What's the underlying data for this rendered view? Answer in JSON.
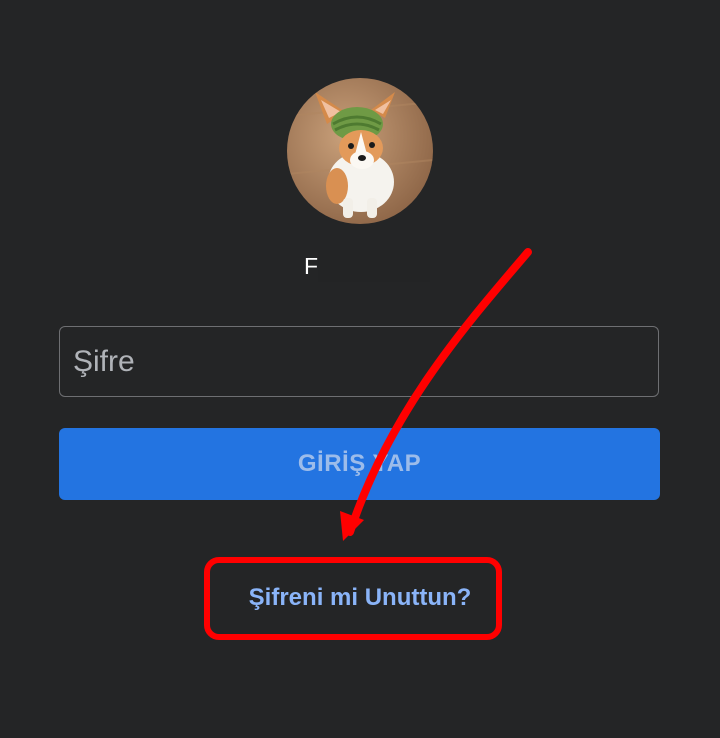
{
  "profile": {
    "username": "F",
    "avatar_alt": "profile-photo-corgi"
  },
  "password": {
    "placeholder": "Şifre",
    "value": ""
  },
  "login_button": {
    "label": "GİRİŞ YAP"
  },
  "forgot_password": {
    "label": "Şifreni mi Unuttun?"
  },
  "colors": {
    "background": "#242526",
    "primary_button": "#2374e1",
    "link": "#8ab4f8",
    "annotation": "#ff0000"
  }
}
